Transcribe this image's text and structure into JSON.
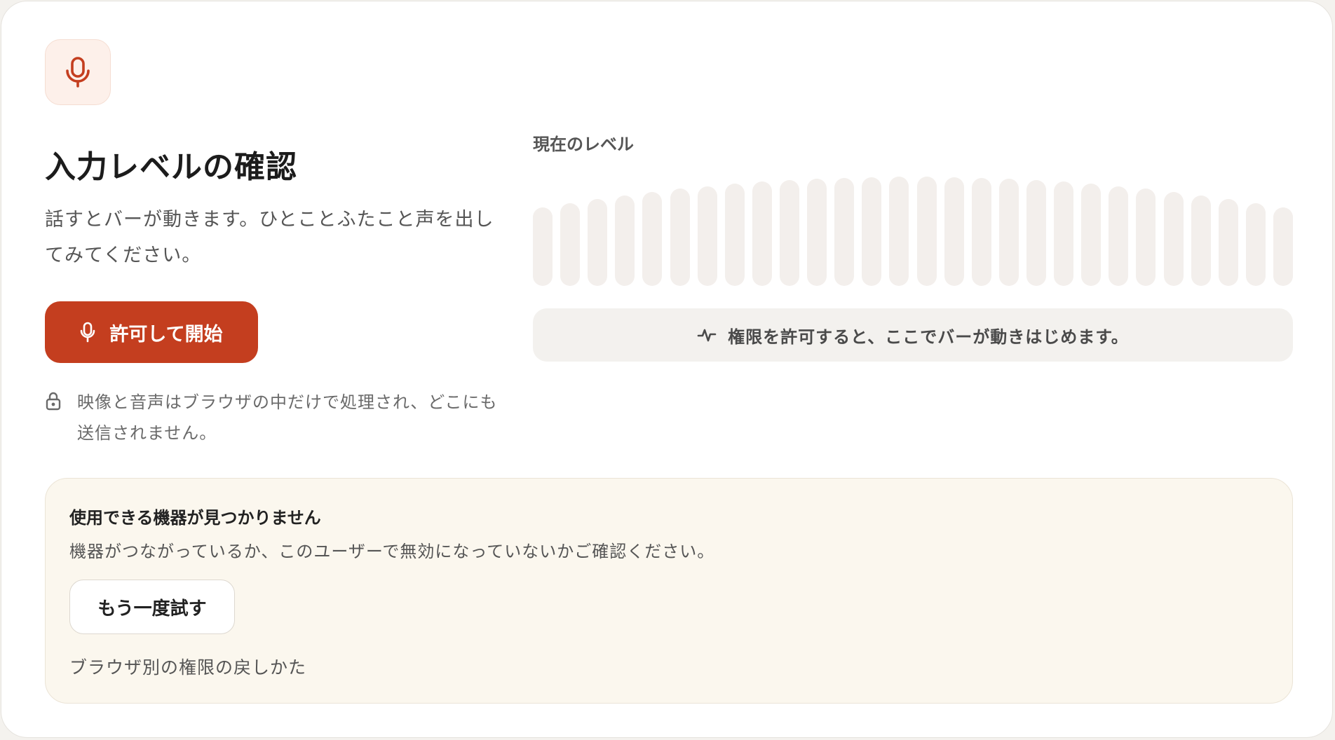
{
  "header": {
    "icon": "microphone-icon",
    "title": "入力レベルの確認",
    "description": "話すとバーが動きます。ひとことふたこと声を出してみてください。"
  },
  "actions": {
    "start_label": "許可して開始",
    "start_icon": "microphone-icon"
  },
  "privacy": {
    "icon": "lock-icon",
    "text": "映像と音声はブラウザの中だけで処理され、どこにも送信されません。"
  },
  "meter": {
    "label": "現在のレベル",
    "bar_count": 28,
    "level": 0,
    "hint_icon": "activity-icon",
    "hint": "権限を許可すると、ここでバーが動きはじめます。"
  },
  "notice": {
    "title": "使用できる機器が見つかりません",
    "description": "機器がつながっているか、このユーザーで無効になっていないかご確認ください。",
    "retry_label": "もう一度試す",
    "help_link": "ブラウザ別の権限の戻しかた"
  },
  "colors": {
    "accent": "#c43e1f",
    "accent_tint": "#fdf0ea",
    "bar_idle": "#f3efec",
    "notice_bg": "#fbf7ee"
  }
}
